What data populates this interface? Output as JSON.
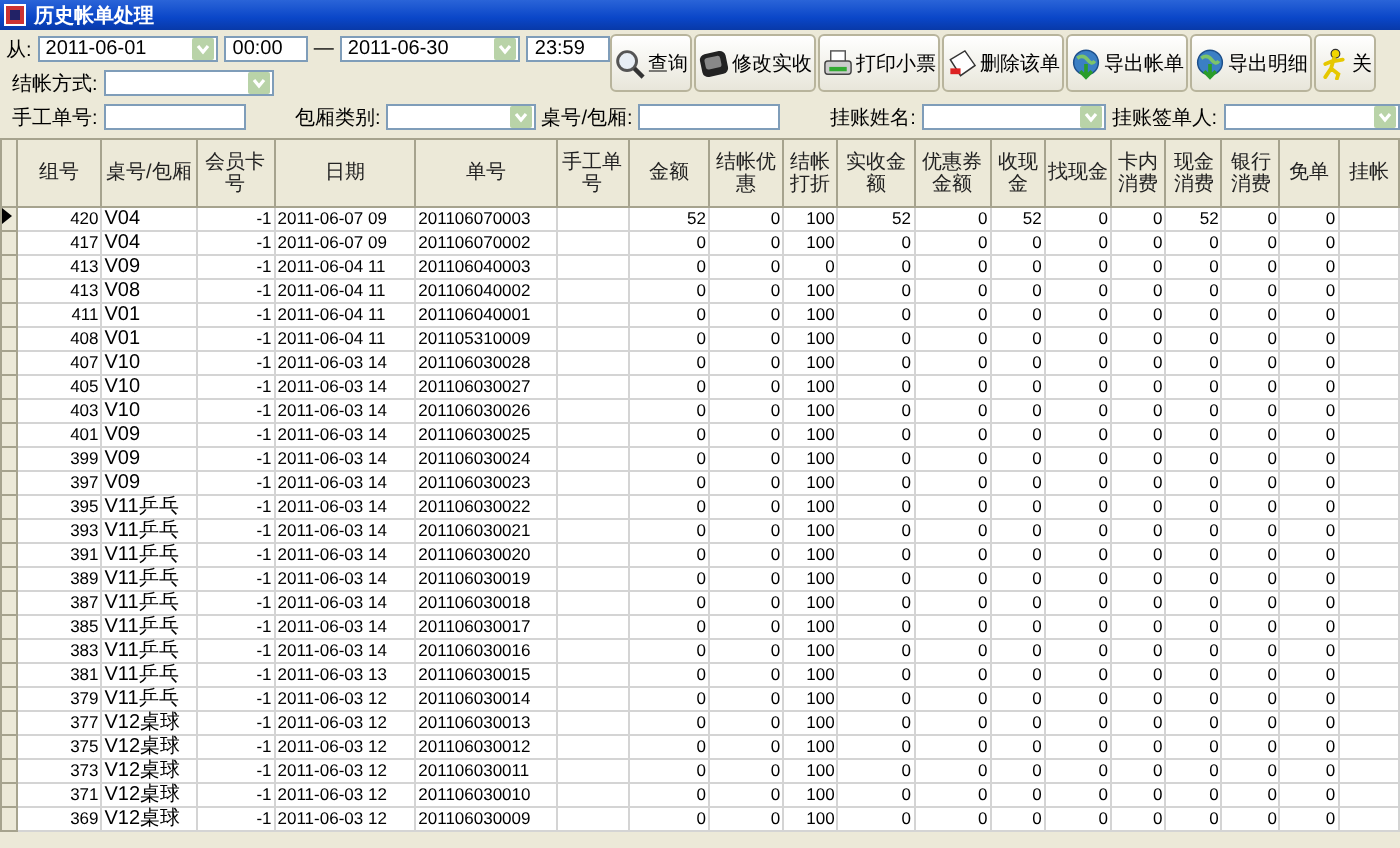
{
  "window": {
    "title": "历史帐单处理"
  },
  "filters": {
    "from_label": "从:",
    "date_from": "2011-06-01",
    "time_from": "00:00",
    "range_sep": "—",
    "date_to": "2011-06-30",
    "time_to": "23:59",
    "settle_label": "结帐方式:",
    "manual_label": "手工单号:",
    "room_type_label": "包厢类别:",
    "table_label": "桌号/包厢:",
    "credit_name_label": "挂账姓名:",
    "credit_signer_label": "挂账签单人:"
  },
  "toolbar": [
    {
      "label": "查询",
      "kind": "search"
    },
    {
      "label": "修改实收",
      "kind": "edit"
    },
    {
      "label": "打印小票",
      "kind": "print"
    },
    {
      "label": "删除该单",
      "kind": "delete"
    },
    {
      "label": "导出帐单",
      "kind": "export"
    },
    {
      "label": "导出明细",
      "kind": "export"
    },
    {
      "label": "关",
      "kind": "close"
    }
  ],
  "table": {
    "columns": [
      "组号",
      "桌号/包厢",
      "会员卡号",
      "日期",
      "单号",
      "手工单号",
      "金额",
      "结帐优惠",
      "结帐打折",
      "实收金额",
      "优惠券金额",
      "收现金",
      "找现金",
      "卡内消费",
      "现金消费",
      "银行消费",
      "免单",
      "挂帐"
    ],
    "rows": [
      {
        "selected": true,
        "cells": [
          "420",
          "V04",
          "-1",
          "2011-06-07 09",
          "201106070003",
          "",
          "52",
          "0",
          "100",
          "52",
          "0",
          "52",
          "0",
          "0",
          "52",
          "0",
          "0",
          ""
        ]
      },
      {
        "selected": false,
        "cells": [
          "417",
          "V04",
          "-1",
          "2011-06-07 09",
          "201106070002",
          "",
          "0",
          "0",
          "100",
          "0",
          "0",
          "0",
          "0",
          "0",
          "0",
          "0",
          "0",
          ""
        ]
      },
      {
        "selected": false,
        "cells": [
          "413",
          "V09",
          "-1",
          "2011-06-04 11",
          "201106040003",
          "",
          "0",
          "0",
          "0",
          "0",
          "0",
          "0",
          "0",
          "0",
          "0",
          "0",
          "0",
          ""
        ]
      },
      {
        "selected": false,
        "cells": [
          "413",
          "V08",
          "-1",
          "2011-06-04 11",
          "201106040002",
          "",
          "0",
          "0",
          "100",
          "0",
          "0",
          "0",
          "0",
          "0",
          "0",
          "0",
          "0",
          ""
        ]
      },
      {
        "selected": false,
        "cells": [
          "411",
          "V01",
          "-1",
          "2011-06-04 11",
          "201106040001",
          "",
          "0",
          "0",
          "100",
          "0",
          "0",
          "0",
          "0",
          "0",
          "0",
          "0",
          "0",
          ""
        ]
      },
      {
        "selected": false,
        "cells": [
          "408",
          "V01",
          "-1",
          "2011-06-04 11",
          "201105310009",
          "",
          "0",
          "0",
          "100",
          "0",
          "0",
          "0",
          "0",
          "0",
          "0",
          "0",
          "0",
          ""
        ]
      },
      {
        "selected": false,
        "cells": [
          "407",
          "V10",
          "-1",
          "2011-06-03 14",
          "201106030028",
          "",
          "0",
          "0",
          "100",
          "0",
          "0",
          "0",
          "0",
          "0",
          "0",
          "0",
          "0",
          ""
        ]
      },
      {
        "selected": false,
        "cells": [
          "405",
          "V10",
          "-1",
          "2011-06-03 14",
          "201106030027",
          "",
          "0",
          "0",
          "100",
          "0",
          "0",
          "0",
          "0",
          "0",
          "0",
          "0",
          "0",
          ""
        ]
      },
      {
        "selected": false,
        "cells": [
          "403",
          "V10",
          "-1",
          "2011-06-03 14",
          "201106030026",
          "",
          "0",
          "0",
          "100",
          "0",
          "0",
          "0",
          "0",
          "0",
          "0",
          "0",
          "0",
          ""
        ]
      },
      {
        "selected": false,
        "cells": [
          "401",
          "V09",
          "-1",
          "2011-06-03 14",
          "201106030025",
          "",
          "0",
          "0",
          "100",
          "0",
          "0",
          "0",
          "0",
          "0",
          "0",
          "0",
          "0",
          ""
        ]
      },
      {
        "selected": false,
        "cells": [
          "399",
          "V09",
          "-1",
          "2011-06-03 14",
          "201106030024",
          "",
          "0",
          "0",
          "100",
          "0",
          "0",
          "0",
          "0",
          "0",
          "0",
          "0",
          "0",
          ""
        ]
      },
      {
        "selected": false,
        "cells": [
          "397",
          "V09",
          "-1",
          "2011-06-03 14",
          "201106030023",
          "",
          "0",
          "0",
          "100",
          "0",
          "0",
          "0",
          "0",
          "0",
          "0",
          "0",
          "0",
          ""
        ]
      },
      {
        "selected": false,
        "cells": [
          "395",
          "V11乒乓",
          "-1",
          "2011-06-03 14",
          "201106030022",
          "",
          "0",
          "0",
          "100",
          "0",
          "0",
          "0",
          "0",
          "0",
          "0",
          "0",
          "0",
          ""
        ]
      },
      {
        "selected": false,
        "cells": [
          "393",
          "V11乒乓",
          "-1",
          "2011-06-03 14",
          "201106030021",
          "",
          "0",
          "0",
          "100",
          "0",
          "0",
          "0",
          "0",
          "0",
          "0",
          "0",
          "0",
          ""
        ]
      },
      {
        "selected": false,
        "cells": [
          "391",
          "V11乒乓",
          "-1",
          "2011-06-03 14",
          "201106030020",
          "",
          "0",
          "0",
          "100",
          "0",
          "0",
          "0",
          "0",
          "0",
          "0",
          "0",
          "0",
          ""
        ]
      },
      {
        "selected": false,
        "cells": [
          "389",
          "V11乒乓",
          "-1",
          "2011-06-03 14",
          "201106030019",
          "",
          "0",
          "0",
          "100",
          "0",
          "0",
          "0",
          "0",
          "0",
          "0",
          "0",
          "0",
          ""
        ]
      },
      {
        "selected": false,
        "cells": [
          "387",
          "V11乒乓",
          "-1",
          "2011-06-03 14",
          "201106030018",
          "",
          "0",
          "0",
          "100",
          "0",
          "0",
          "0",
          "0",
          "0",
          "0",
          "0",
          "0",
          ""
        ]
      },
      {
        "selected": false,
        "cells": [
          "385",
          "V11乒乓",
          "-1",
          "2011-06-03 14",
          "201106030017",
          "",
          "0",
          "0",
          "100",
          "0",
          "0",
          "0",
          "0",
          "0",
          "0",
          "0",
          "0",
          ""
        ]
      },
      {
        "selected": false,
        "cells": [
          "383",
          "V11乒乓",
          "-1",
          "2011-06-03 14",
          "201106030016",
          "",
          "0",
          "0",
          "100",
          "0",
          "0",
          "0",
          "0",
          "0",
          "0",
          "0",
          "0",
          ""
        ]
      },
      {
        "selected": false,
        "cells": [
          "381",
          "V11乒乓",
          "-1",
          "2011-06-03 13",
          "201106030015",
          "",
          "0",
          "0",
          "100",
          "0",
          "0",
          "0",
          "0",
          "0",
          "0",
          "0",
          "0",
          ""
        ]
      },
      {
        "selected": false,
        "cells": [
          "379",
          "V11乒乓",
          "-1",
          "2011-06-03 12",
          "201106030014",
          "",
          "0",
          "0",
          "100",
          "0",
          "0",
          "0",
          "0",
          "0",
          "0",
          "0",
          "0",
          ""
        ]
      },
      {
        "selected": false,
        "cells": [
          "377",
          "V12桌球",
          "-1",
          "2011-06-03 12",
          "201106030013",
          "",
          "0",
          "0",
          "100",
          "0",
          "0",
          "0",
          "0",
          "0",
          "0",
          "0",
          "0",
          ""
        ]
      },
      {
        "selected": false,
        "cells": [
          "375",
          "V12桌球",
          "-1",
          "2011-06-03 12",
          "201106030012",
          "",
          "0",
          "0",
          "100",
          "0",
          "0",
          "0",
          "0",
          "0",
          "0",
          "0",
          "0",
          ""
        ]
      },
      {
        "selected": false,
        "cells": [
          "373",
          "V12桌球",
          "-1",
          "2011-06-03 12",
          "201106030011",
          "",
          "0",
          "0",
          "100",
          "0",
          "0",
          "0",
          "0",
          "0",
          "0",
          "0",
          "0",
          ""
        ]
      },
      {
        "selected": false,
        "cells": [
          "371",
          "V12桌球",
          "-1",
          "2011-06-03 12",
          "201106030010",
          "",
          "0",
          "0",
          "100",
          "0",
          "0",
          "0",
          "0",
          "0",
          "0",
          "0",
          "0",
          ""
        ]
      },
      {
        "selected": false,
        "cells": [
          "369",
          "V12桌球",
          "-1",
          "2011-06-03 12",
          "201106030009",
          "",
          "0",
          "0",
          "100",
          "0",
          "0",
          "0",
          "0",
          "0",
          "0",
          "0",
          "0",
          ""
        ]
      }
    ]
  }
}
